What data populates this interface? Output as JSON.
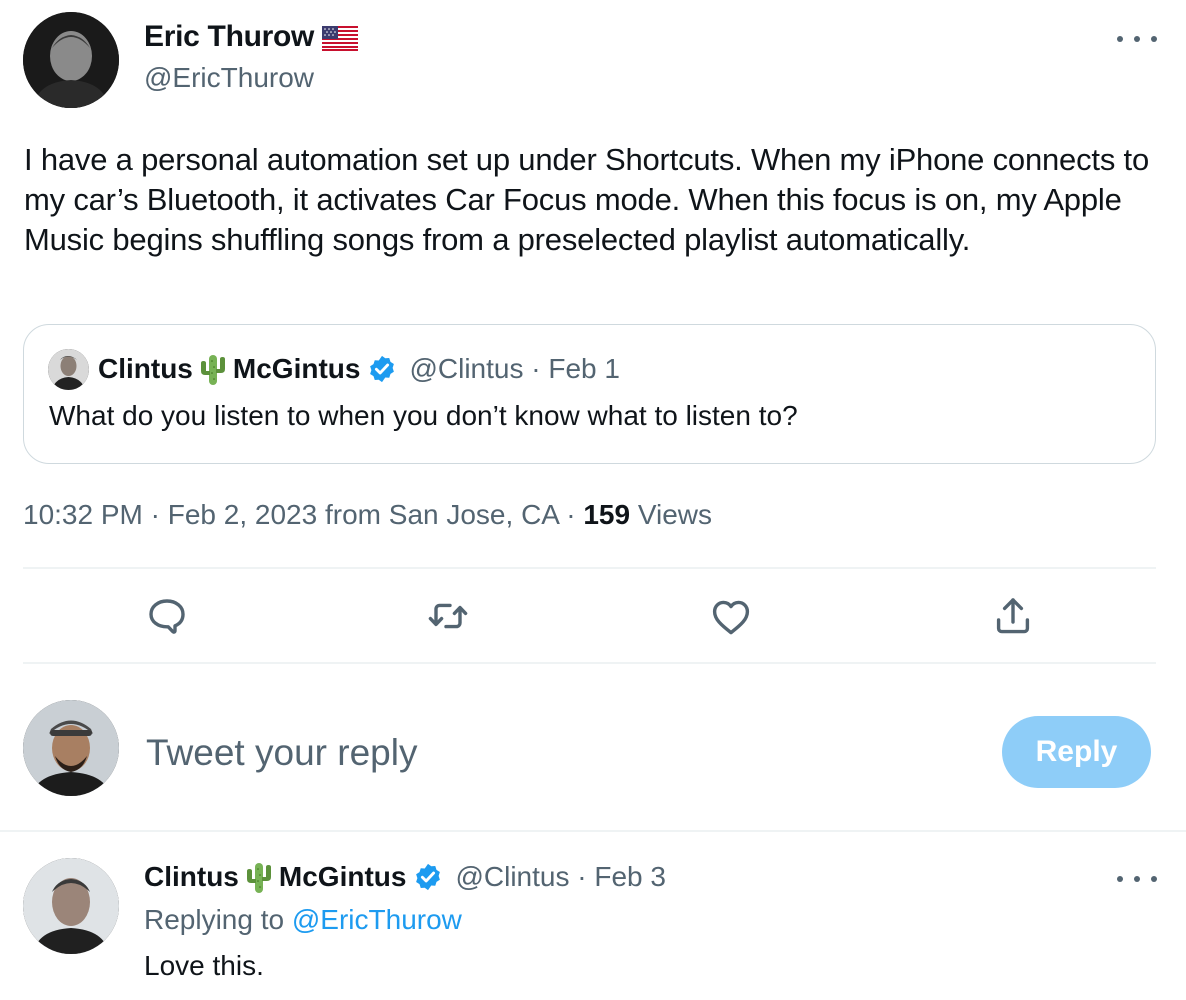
{
  "tweet": {
    "author": {
      "name": "Eric Thurow",
      "handle": "@EricThurow",
      "flag_emoji": "us-flag"
    },
    "text": "I have a personal automation set up under Shortcuts. When my iPhone connects to my car’s Bluetooth, it activates Car Focus mode. When this focus is on, my Apple Music begins shuffling songs from a preselected playlist automatically.",
    "quoted": {
      "name_first": "Clintus",
      "name_last": "McGintus",
      "name_emoji": "cactus",
      "handle": "@Clintus",
      "date": "Feb 1",
      "separator": " · ",
      "text": "What do you listen to when you don’t know what to listen to?"
    },
    "meta": {
      "time": "10:32 PM",
      "date": "Feb 2, 2023",
      "location": "from San Jose, CA",
      "separator": " · ",
      "views_count": "159",
      "views_label": "Views"
    },
    "actions": [
      "reply-icon",
      "retweet-icon",
      "like-icon",
      "share-icon"
    ]
  },
  "composer": {
    "placeholder": "Tweet your reply",
    "button_label": "Reply"
  },
  "reply": {
    "name_first": "Clintus",
    "name_last": "McGintus",
    "handle": "@Clintus",
    "date": "Feb 3",
    "separator": " · ",
    "replying_prefix": "Replying to",
    "replying_handle": "@EricThurow",
    "text": "Love this."
  },
  "colors": {
    "text": "#0f1419",
    "muted": "#536471",
    "accent": "#1d9bf0",
    "reply_button_disabled": "#8ecdf8",
    "border": "#cfd9de",
    "divider": "#eff3f4"
  }
}
